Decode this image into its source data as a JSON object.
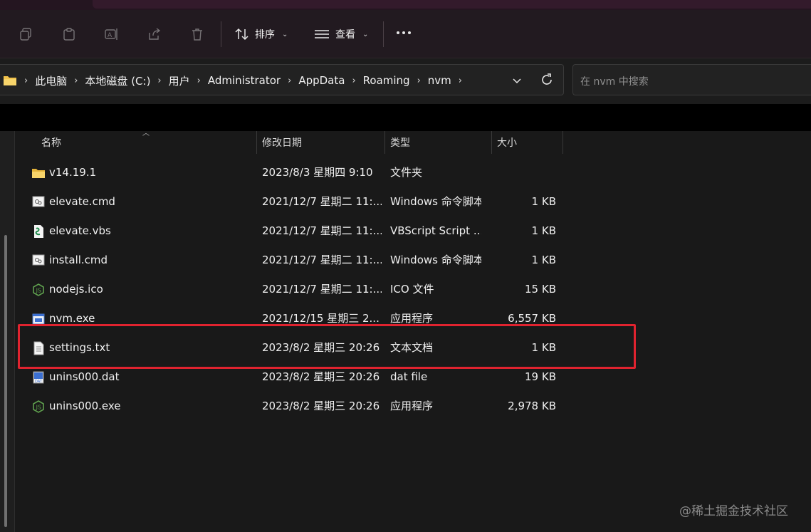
{
  "toolbar": {
    "sort_label": "排序",
    "view_label": "查看",
    "icons": [
      "copy-icon",
      "paste-icon",
      "rename-icon",
      "share-icon",
      "delete-icon",
      "sort-icon",
      "view-icon",
      "more-icon"
    ]
  },
  "address": {
    "crumbs": [
      "此电脑",
      "本地磁盘 (C:)",
      "用户",
      "Administrator",
      "AppData",
      "Roaming",
      "nvm"
    ],
    "search_placeholder": "在 nvm 中搜索"
  },
  "table": {
    "columns": [
      "名称",
      "修改日期",
      "类型",
      "大小"
    ],
    "rows": [
      {
        "name": "v14.19.1",
        "date": "2023/8/3 星期四 9:10",
        "type": "文件夹",
        "size": "",
        "icon": "folder-icon"
      },
      {
        "name": "elevate.cmd",
        "date": "2021/12/7 星期二 11:...",
        "type": "Windows 命令脚本",
        "size": "1 KB",
        "icon": "cmd-file-icon"
      },
      {
        "name": "elevate.vbs",
        "date": "2021/12/7 星期二 11:...",
        "type": "VBScript Script ...",
        "size": "1 KB",
        "icon": "vbs-file-icon"
      },
      {
        "name": "install.cmd",
        "date": "2021/12/7 星期二 11:...",
        "type": "Windows 命令脚本",
        "size": "1 KB",
        "icon": "cmd-file-icon"
      },
      {
        "name": "nodejs.ico",
        "date": "2021/12/7 星期二 11:...",
        "type": "ICO 文件",
        "size": "15 KB",
        "icon": "nodejs-icon"
      },
      {
        "name": "nvm.exe",
        "date": "2021/12/15 星期三 2...",
        "type": "应用程序",
        "size": "6,557 KB",
        "icon": "exe-file-icon"
      },
      {
        "name": "settings.txt",
        "date": "2023/8/2 星期三 20:26",
        "type": "文本文档",
        "size": "1 KB",
        "icon": "text-file-icon"
      },
      {
        "name": "unins000.dat",
        "date": "2023/8/2 星期三 20:26",
        "type": "dat file",
        "size": "19 KB",
        "icon": "dat-file-icon"
      },
      {
        "name": "unins000.exe",
        "date": "2023/8/2 星期三 20:26",
        "type": "应用程序",
        "size": "2,978 KB",
        "icon": "nodejs-icon"
      }
    ]
  },
  "highlight_color": "#e0232f",
  "watermark": "@稀土掘金技术社区"
}
